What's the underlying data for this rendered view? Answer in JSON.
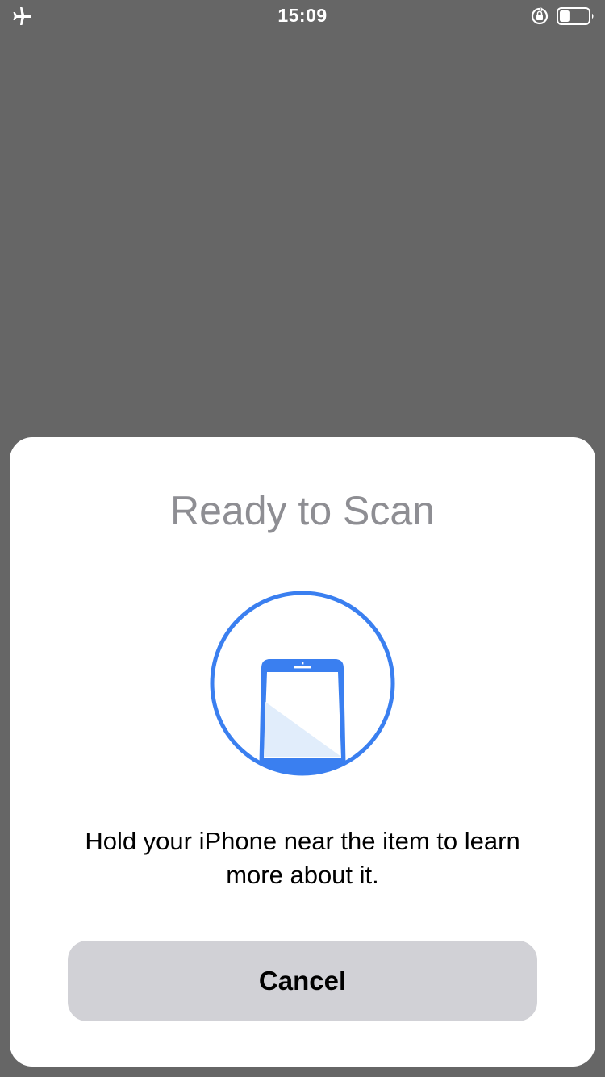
{
  "status_bar": {
    "time": "15:09",
    "left_icon": "airplane-icon",
    "right_icons": [
      "orientation-lock-icon",
      "battery-icon"
    ],
    "battery_level": 0.35
  },
  "sheet": {
    "title": "Ready to Scan",
    "graphic_icon": "phone-scan-icon",
    "instructions": "Hold your iPhone near the item to learn more about it.",
    "cancel_label": "Cancel"
  },
  "colors": {
    "backdrop": "#666666",
    "accent": "#3a7ff0",
    "accent_light": "#e1edfb",
    "title_gray": "#8e8e93",
    "button_bg": "#d1d1d6"
  }
}
